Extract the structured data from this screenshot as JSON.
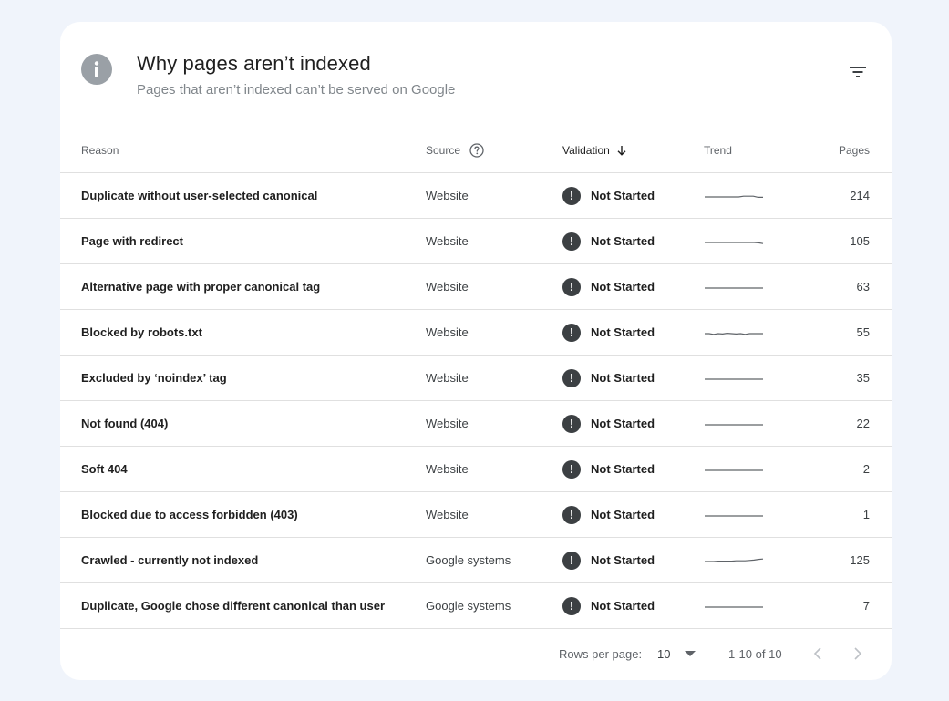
{
  "header": {
    "title": "Why pages aren’t indexed",
    "subtitle": "Pages that aren’t indexed can’t be served on Google"
  },
  "columns": {
    "reason": "Reason",
    "source": "Source",
    "validation": "Validation",
    "trend": "Trend",
    "pages": "Pages"
  },
  "rows": [
    {
      "reason": "Duplicate without user-selected canonical",
      "source": "Website",
      "validation": "Not Started",
      "pages": "214",
      "trend": [
        0,
        0,
        0,
        0,
        0,
        0,
        0,
        0,
        0.2,
        0.2,
        0.2,
        -0.1,
        -0.1
      ]
    },
    {
      "reason": "Page with redirect",
      "source": "Website",
      "validation": "Not Started",
      "pages": "105",
      "trend": [
        0,
        0,
        0,
        0,
        0,
        0,
        0,
        0,
        0,
        0,
        0,
        0,
        -0.1,
        -0.3
      ]
    },
    {
      "reason": "Alternative page with proper canonical tag",
      "source": "Website",
      "validation": "Not Started",
      "pages": "63",
      "trend": [
        0,
        0,
        0,
        0,
        0,
        0,
        0,
        0,
        0,
        0,
        0,
        0,
        0,
        0
      ]
    },
    {
      "reason": "Blocked by robots.txt",
      "source": "Website",
      "validation": "Not Started",
      "pages": "55",
      "trend": [
        0,
        0,
        -0.2,
        0,
        -0.1,
        0.1,
        0,
        -0.1,
        0,
        -0.2,
        0,
        0,
        0,
        0
      ]
    },
    {
      "reason": "Excluded by ‘noindex’ tag",
      "source": "Website",
      "validation": "Not Started",
      "pages": "35",
      "trend": [
        0,
        0,
        0,
        0,
        0,
        0,
        0,
        0,
        0,
        0,
        0,
        0,
        0,
        0
      ]
    },
    {
      "reason": "Not found (404)",
      "source": "Website",
      "validation": "Not Started",
      "pages": "22",
      "trend": [
        0,
        0,
        0,
        0,
        0,
        0,
        0,
        0,
        0,
        0,
        0,
        0,
        0,
        0
      ]
    },
    {
      "reason": "Soft 404",
      "source": "Website",
      "validation": "Not Started",
      "pages": "2",
      "trend": [
        0,
        0,
        0,
        0,
        0,
        0,
        0,
        0,
        0,
        0,
        0,
        0,
        0,
        0
      ]
    },
    {
      "reason": "Blocked due to access forbidden (403)",
      "source": "Website",
      "validation": "Not Started",
      "pages": "1",
      "trend": [
        0,
        0,
        0,
        0,
        0,
        0,
        0,
        0,
        0,
        0,
        0,
        0,
        0,
        0
      ]
    },
    {
      "reason": "Crawled - currently not indexed",
      "source": "Google systems",
      "validation": "Not Started",
      "pages": "125",
      "trend": [
        0,
        0,
        0,
        0.1,
        0.1,
        0.1,
        0.1,
        0.2,
        0.2,
        0.2,
        0.3,
        0.4,
        0.6,
        0.7
      ]
    },
    {
      "reason": "Duplicate, Google chose different canonical than user",
      "source": "Google systems",
      "validation": "Not Started",
      "pages": "7",
      "trend": [
        0,
        0,
        0,
        0,
        0,
        0,
        0,
        0,
        0,
        0,
        0,
        0,
        0,
        0
      ]
    }
  ],
  "footer": {
    "rows_per_page_label": "Rows per page:",
    "rows_per_page_value": "10",
    "range": "1-10 of 10"
  },
  "icons": {
    "info": "info-icon",
    "filter": "filter-icon",
    "help": "help-icon",
    "sort": "arrow-down-icon",
    "status": "exclamation-icon",
    "prev": "chevron-left-icon",
    "next": "chevron-right-icon",
    "dropdown": "caret-down-icon"
  },
  "colors": {
    "background": "#f0f4fb",
    "card": "#ffffff",
    "status_icon": "#3c4043",
    "info_icon": "#9aa0a6"
  }
}
